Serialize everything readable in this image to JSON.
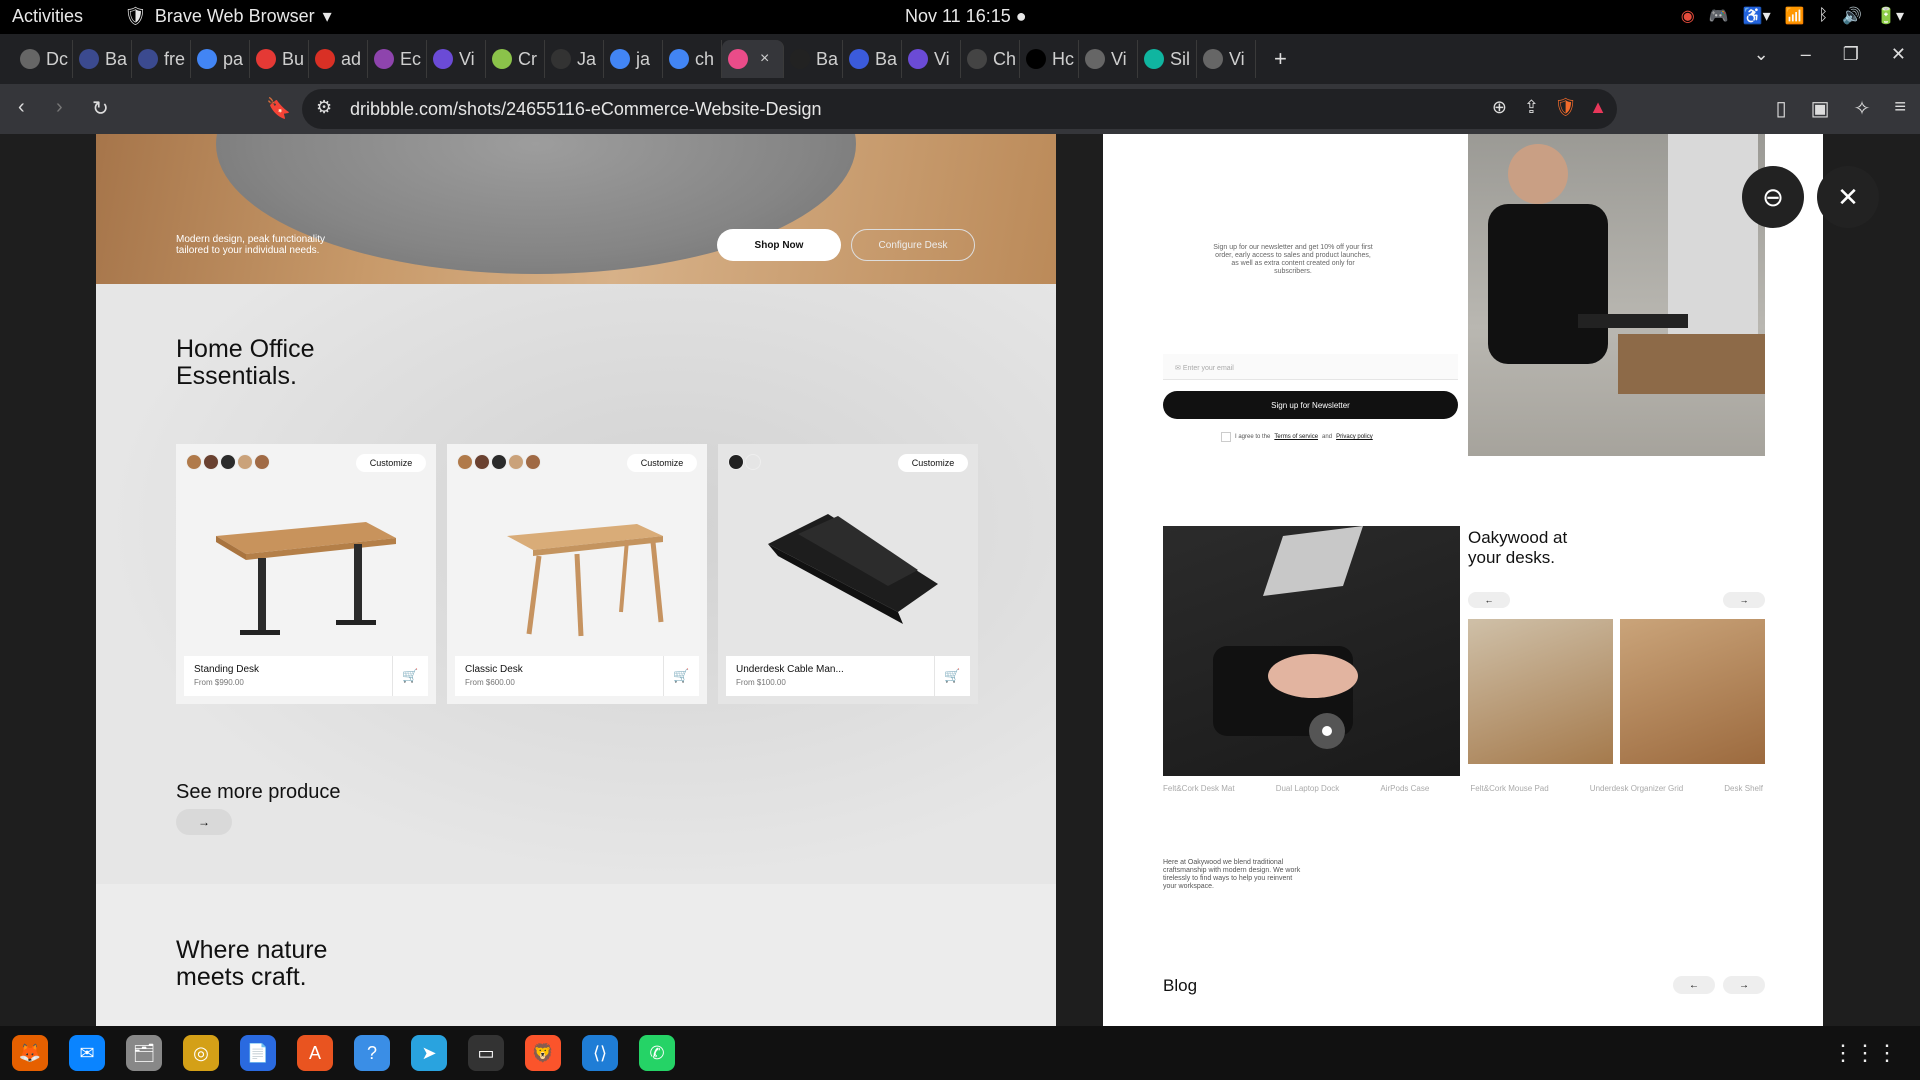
{
  "system": {
    "activities": "Activities",
    "app_name": "Brave Web Browser",
    "clock": "Nov 11  16:15"
  },
  "tabs": [
    {
      "label": "Dc",
      "color": "#666"
    },
    {
      "label": "Ba",
      "color": "#3b4a8f"
    },
    {
      "label": "fre",
      "color": "#3b4a8f"
    },
    {
      "label": "pa",
      "color": "#4285f4"
    },
    {
      "label": "Bu",
      "color": "#e53935"
    },
    {
      "label": "ad",
      "color": "#d93025"
    },
    {
      "label": "Ec",
      "color": "#8e44ad"
    },
    {
      "label": "Vi",
      "color": "#6b4bd6"
    },
    {
      "label": "Cr",
      "color": "#8bc34a"
    },
    {
      "label": "Ja",
      "color": "#333"
    },
    {
      "label": "ja",
      "color": "#4285f4"
    },
    {
      "label": "ch",
      "color": "#4285f4"
    },
    {
      "label": "×",
      "color": "#ea4c89",
      "active": true
    },
    {
      "label": "Ba",
      "color": "#222"
    },
    {
      "label": "Ba",
      "color": "#3b5bdb"
    },
    {
      "label": "Vi",
      "color": "#6b4bd6"
    },
    {
      "label": "Ch",
      "color": "#444"
    },
    {
      "label": "Hc",
      "color": "#000"
    },
    {
      "label": "Vi",
      "color": "#666"
    },
    {
      "label": "Sil",
      "color": "#10b5a0"
    },
    {
      "label": "Vi",
      "color": "#666"
    }
  ],
  "address": {
    "url": "dribbble.com/shots/24655116-eCommerce-Website-Design"
  },
  "left_page": {
    "hero_tagline_1": "Modern design, peak functionality",
    "hero_tagline_2": "tailored to your individual needs.",
    "shop_now": "Shop Now",
    "configure": "Configure Desk",
    "section_title_1": "Home Office",
    "section_title_2": "Essentials.",
    "products": [
      {
        "name": "Standing Desk",
        "price": "From $990.00",
        "customize": "Customize",
        "swatches": [
          "#b07a4a",
          "#6a4130",
          "#2b2b2b",
          "#caa27a",
          "#a06a45"
        ]
      },
      {
        "name": "Classic Desk",
        "price": "From $600.00",
        "customize": "Customize",
        "swatches": [
          "#b07a4a",
          "#6a4130",
          "#2b2b2b",
          "#caa27a",
          "#a06a45"
        ]
      },
      {
        "name": "Underdesk Cable Man...",
        "price": "From $100.00",
        "customize": "Customize",
        "swatches": [
          "#222222",
          "#e5e5e5"
        ]
      }
    ],
    "see_more": "See more produce",
    "arrow": "→",
    "nature_1": "Where nature",
    "nature_2": "meets craft."
  },
  "right_page": {
    "newsletter_copy": "Sign up for our newsletter and get 10% off your first order, early access to sales and product launches, as well as extra content created only for subscribers.",
    "email_placeholder": "Enter your email",
    "signup": "Sign up for Newsletter",
    "agree_prefix": "I agree to the",
    "terms": "Terms of service",
    "and": "and",
    "privacy": "Privacy policy",
    "oak_title_1": "Oakywood at",
    "oak_title_2": "your desks.",
    "prev": "←",
    "next": "→",
    "product_labels": [
      "Felt&Cork Desk Mat",
      "Dual Laptop Dock",
      "AirPods Case",
      "Felt&Cork Mouse Pad",
      "Underdesk Organizer Grid",
      "Desk Shelf"
    ],
    "about": "Here at Oakywood we blend traditional craftsmanship with modern design. We work tirelessly to find ways to help you reinvent your workspace.",
    "blog": "Blog"
  },
  "dock": [
    "firefox-icon",
    "thunderbird-icon",
    "files-icon",
    "rhythmbox-icon",
    "writer-icon",
    "software-icon",
    "help-icon",
    "telegram-icon",
    "terminal-icon",
    "brave-icon",
    "vscode-icon",
    "whatsapp-icon"
  ]
}
